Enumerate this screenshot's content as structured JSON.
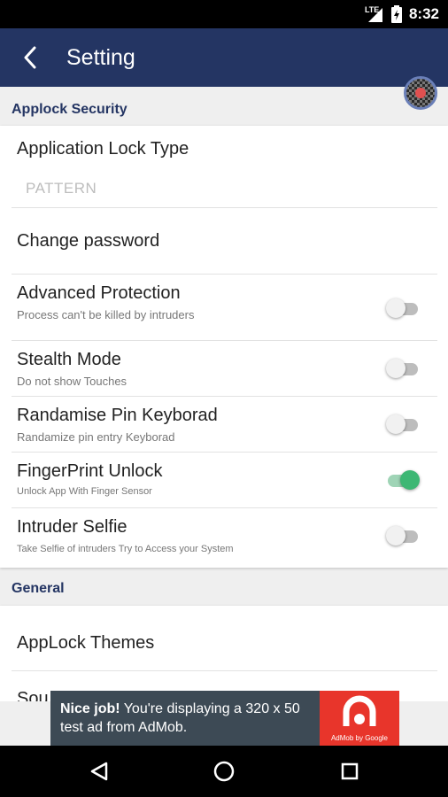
{
  "status_bar": {
    "network": "LTE",
    "time": "8:32"
  },
  "app_bar": {
    "title": "Setting",
    "back_icon": "back-arrow-icon"
  },
  "sections": {
    "applock_security": {
      "header": "Applock Security",
      "lock_type": {
        "title": "Application Lock Type",
        "value": "PATTERN"
      },
      "change_password": {
        "title": "Change password"
      },
      "advanced_protection": {
        "title": "Advanced Protection",
        "subtitle": "Process can't be killed by intruders",
        "enabled": false
      },
      "stealth_mode": {
        "title": "Stealth Mode",
        "subtitle": "Do not show Touches",
        "enabled": false
      },
      "randomise_pin": {
        "title": "Randamise Pin Keyborad",
        "subtitle": "Randamize pin entry Keyborad",
        "enabled": false
      },
      "fingerprint": {
        "title": "FingerPrint Unlock",
        "subtitle": "Unlock App With Finger Sensor",
        "enabled": true
      },
      "intruder_selfie": {
        "title": "Intruder Selfie",
        "subtitle": "Take Selfie of intruders Try to Access your System",
        "enabled": false
      }
    },
    "general": {
      "header": "General",
      "themes": {
        "title": "AppLock Themes"
      },
      "partial_row": {
        "title": "Sou"
      }
    }
  },
  "ad": {
    "headline": "Nice job!",
    "body": " You're displaying a 320 x 50 test ad from AdMob.",
    "logo_caption": "AdMob by Google"
  },
  "colors": {
    "app_bar": "#243563",
    "accent_on": "#3db774",
    "ad_bg": "#3d4a55",
    "ad_logo": "#e8352b"
  }
}
